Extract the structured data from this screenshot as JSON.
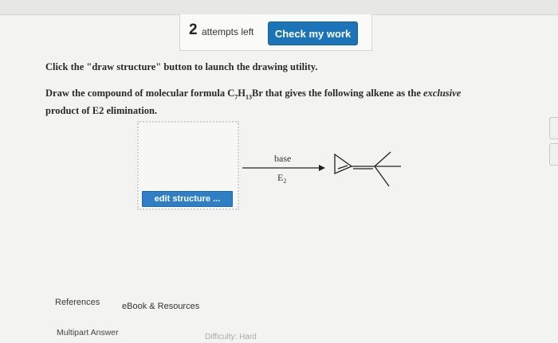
{
  "header": {
    "attempts_count": "2",
    "attempts_label": "attempts left",
    "check_button": "Check my work"
  },
  "question": {
    "instruction": "Click the \"draw structure\" button to launch the drawing utility.",
    "prompt_before": "Draw the compound of molecular formula C",
    "sub_c": "7",
    "h": "H",
    "sub_h": "13",
    "prompt_mid": "Br that gives the following alkene as the ",
    "prompt_italic": "exclusive",
    "prompt_after": "product of E2 elimination."
  },
  "editor": {
    "edit_button": "edit structure ..."
  },
  "reaction": {
    "reagent_top": "base",
    "reagent_bottom_main": "E",
    "reagent_bottom_sub": "2"
  },
  "footer": {
    "references": "References",
    "ebook": "eBook & Resources",
    "multipart": "Multipart Answer",
    "difficulty": "Difficulty: Hard"
  },
  "colors": {
    "primary_button": "#1c74b8",
    "edit_button": "#2f7fc6",
    "background": "#f3f3f1"
  }
}
